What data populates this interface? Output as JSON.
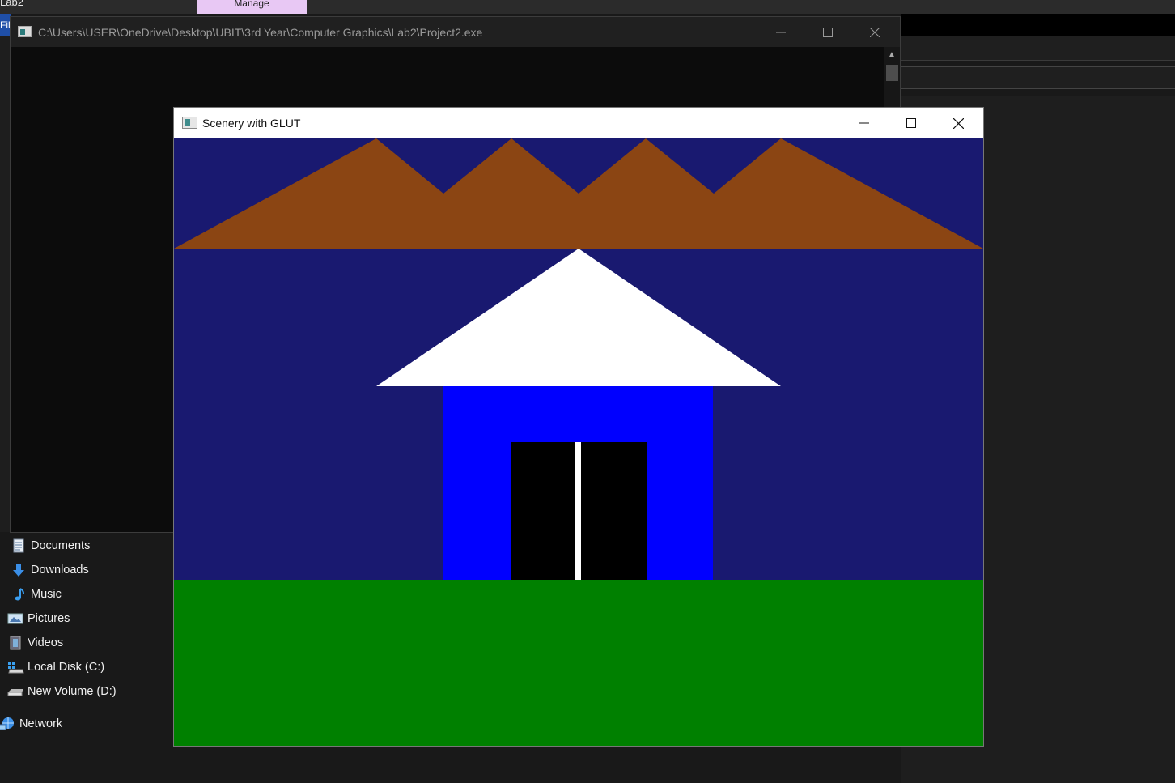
{
  "explorer": {
    "window_title": "Lab2",
    "ribbon_tab": "Manage",
    "file_tab": "File",
    "nav_items": [
      {
        "label": "Documents",
        "icon": "documents-icon"
      },
      {
        "label": "Downloads",
        "icon": "downloads-icon"
      },
      {
        "label": "Music",
        "icon": "music-icon"
      },
      {
        "label": "Pictures",
        "icon": "pictures-icon"
      },
      {
        "label": "Videos",
        "icon": "videos-icon"
      },
      {
        "label": "Local Disk (C:)",
        "icon": "local-disk-icon"
      },
      {
        "label": "New Volume (D:)",
        "icon": "drive-icon"
      },
      {
        "label": "Network",
        "icon": "network-icon"
      }
    ]
  },
  "console": {
    "title": "C:\\Users\\USER\\OneDrive\\Desktop\\UBIT\\3rd Year\\Computer Graphics\\Lab2\\Project2.exe"
  },
  "glut": {
    "title": "Scenery with GLUT",
    "colors": {
      "sky": "#191970",
      "mountains": "#8B4513",
      "roof": "#FFFFFF",
      "house_wall": "#0000FF",
      "door": "#000000",
      "door_split": "#FFFFFF",
      "grass": "#008000"
    }
  }
}
